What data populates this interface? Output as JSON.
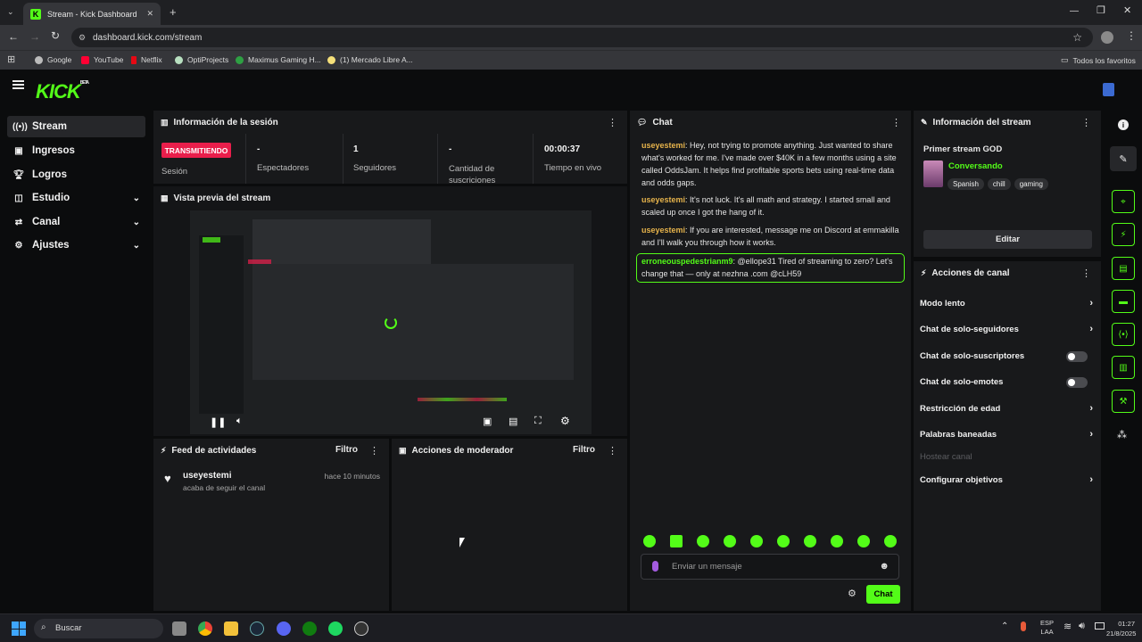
{
  "browser": {
    "tab_title": "Stream - Kick Dashboard",
    "url": "dashboard.kick.com/stream",
    "bookmarks": [
      "Google",
      "YouTube",
      "Netflix",
      "OptiProjects",
      "Maximus Gaming H...",
      "(1) Mercado Libre A..."
    ],
    "bookmarks_right": "Todos los favoritos"
  },
  "logo": "KICK",
  "logo_beta": "BETA",
  "sidebar": {
    "items": [
      {
        "label": "Stream",
        "icon": "broadcast-icon"
      },
      {
        "label": "Ingresos",
        "icon": "wallet-icon"
      },
      {
        "label": "Logros",
        "icon": "trophy-icon"
      },
      {
        "label": "Estudio",
        "icon": "studio-icon"
      },
      {
        "label": "Canal",
        "icon": "channel-icon"
      },
      {
        "label": "Ajustes",
        "icon": "gear-icon"
      }
    ]
  },
  "session": {
    "title": "Información de la sesión",
    "status_badge": "TRANSMITIENDO",
    "session_label": "Sesión",
    "viewers_value": "-",
    "viewers_label": "Espectadores",
    "followers_value": "1",
    "followers_label": "Seguidores",
    "subs_value": "-",
    "subs_label": "Cantidad de suscriciones",
    "live_value": "00:00:37",
    "live_label": "Tiempo en vivo"
  },
  "preview": {
    "title": "Vista previa del stream"
  },
  "activity": {
    "title": "Feed de actividades",
    "filter": "Filtro",
    "entry_user": "useyestemi",
    "entry_text": "acaba de seguir el canal",
    "entry_time": "hace 10 minutos"
  },
  "modactions": {
    "title": "Acciones de moderador",
    "filter": "Filtro"
  },
  "chat": {
    "title": "Chat",
    "messages": [
      {
        "user": "useyestemi",
        "text": ": Hey, not trying to promote anything. Just wanted to share what's worked for me. I've made over $40K in a few months using a site called OddsJam. It helps find profitable sports bets using real-time data and odds gaps."
      },
      {
        "user": "useyestemi",
        "text": ": It's not luck. It's all math and strategy. I started small and scaled up once I got the hang of it."
      },
      {
        "user": "useyestemi",
        "text": ": If you are interested, message me on Discord at emmakilla and I'll walk you through how it works."
      },
      {
        "user": "erroneouspedestrianm9",
        "text": ": @ellope31 Tired of streaming to zero? Let's change that — only at nezhna .com @cLH59"
      }
    ],
    "input_placeholder": "Enviar un mensaje",
    "send_label": "Chat"
  },
  "streaminfo": {
    "title": "Información del stream",
    "stream_title": "Primer stream GOD",
    "category": "Conversando",
    "tags": [
      "Spanish",
      "chill",
      "gaming"
    ],
    "edit_label": "Editar"
  },
  "channelactions": {
    "title": "Acciones de canal",
    "items": [
      {
        "label": "Modo lento",
        "control": "arrow"
      },
      {
        "label": "Chat de solo-seguidores",
        "control": "arrow"
      },
      {
        "label": "Chat de solo-suscriptores",
        "control": "toggle"
      },
      {
        "label": "Chat de solo-emotes",
        "control": "toggle"
      },
      {
        "label": "Restricción de edad",
        "control": "arrow"
      },
      {
        "label": "Palabras baneadas",
        "control": "arrow"
      },
      {
        "label": "Hostear canal",
        "control": "disabled"
      },
      {
        "label": "Configurar objetivos",
        "control": "arrow"
      }
    ]
  },
  "taskbar": {
    "search_placeholder": "Buscar",
    "lang_top": "ESP",
    "lang_bottom": "LAA",
    "time": "01:27",
    "date": "21/8/2025"
  },
  "colors": {
    "accent": "#53fc18",
    "live": "#e91e4b",
    "username": "#e6b34b",
    "username_highlight": "#53fc18"
  }
}
